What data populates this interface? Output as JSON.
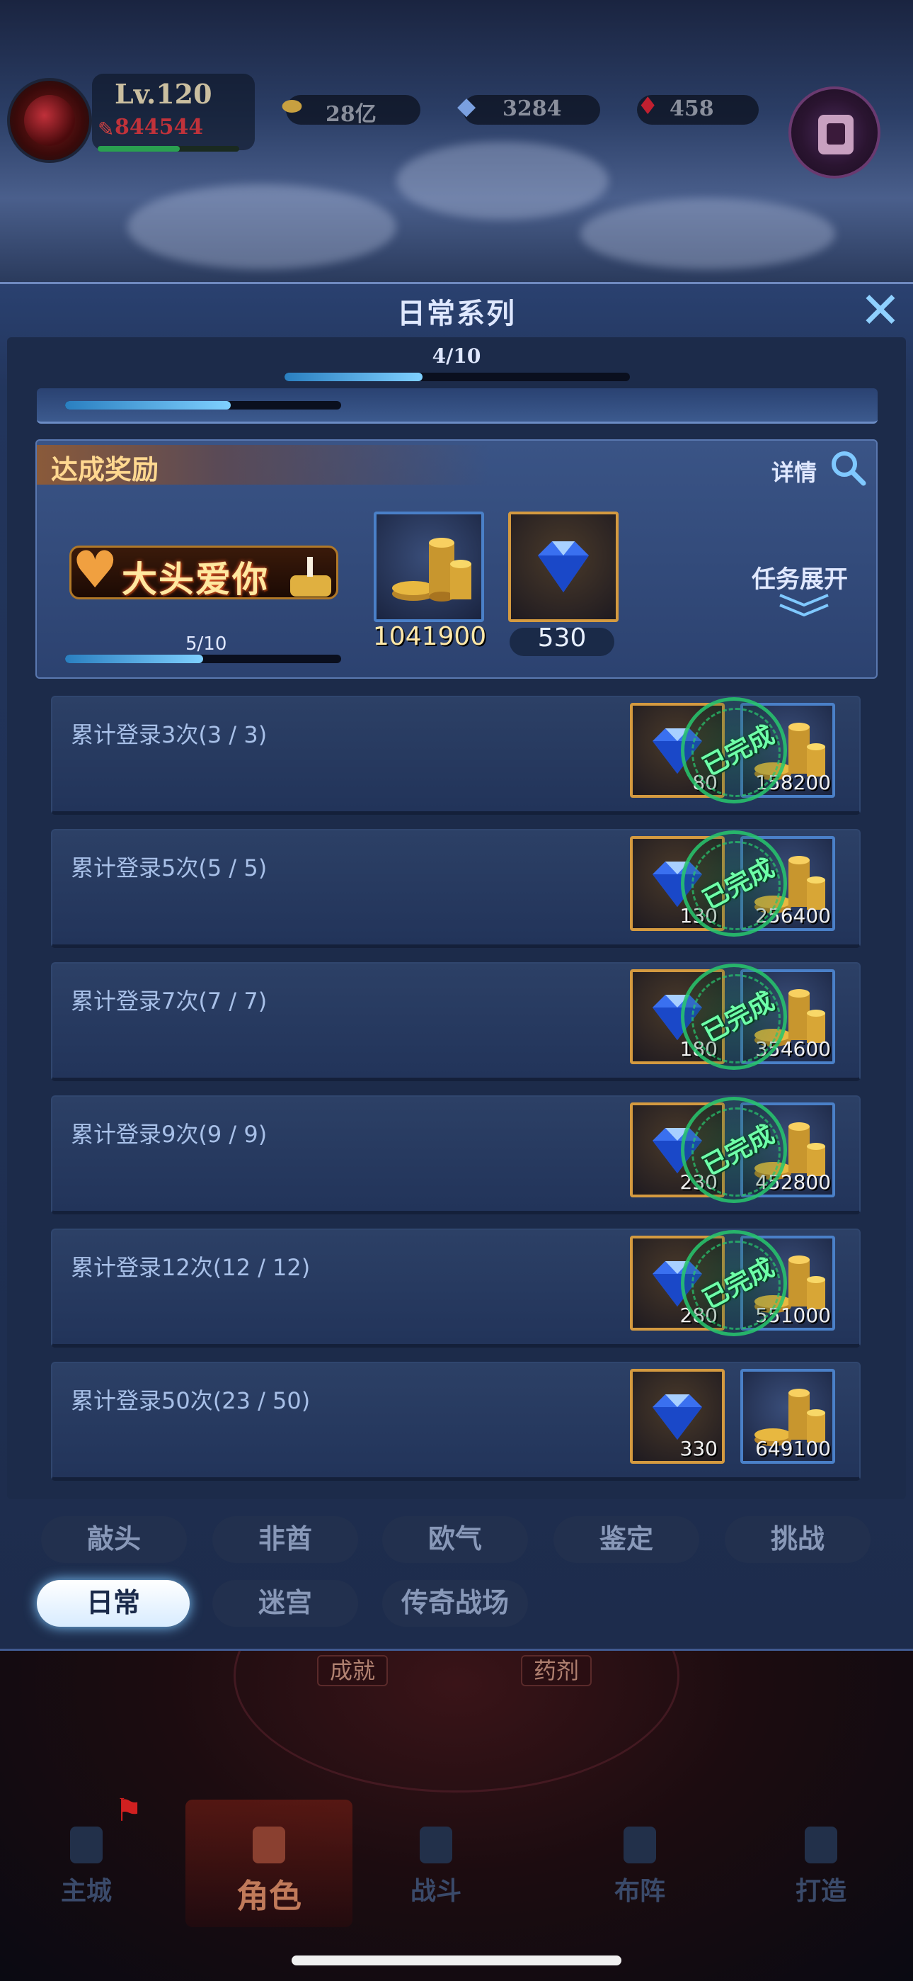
{
  "player": {
    "level": "Lv.120",
    "power": "844544",
    "hp_fraction": 0.58
  },
  "resources": [
    {
      "icon": "gold-coin-icon",
      "value": "28亿"
    },
    {
      "icon": "blue-crystal-icon",
      "value": "3284"
    },
    {
      "icon": "red-gem-icon",
      "value": "458"
    }
  ],
  "panel": {
    "title": "日常系列",
    "progress_label": "4/10",
    "progress_fraction": 0.4,
    "prev_progress_fraction": 0.6
  },
  "achievement": {
    "title": "达成奖励",
    "detail_label": "详情",
    "badge_text": "大头爱你",
    "progress_label": "5/10",
    "progress_fraction": 0.5,
    "reward_gold": "1041900",
    "reward_diamond": "530",
    "expand_label": "任务展开"
  },
  "tasks": [
    {
      "label": "累计登录3次(3 / 3)",
      "diamond": "80",
      "gold": "158200",
      "completed": true,
      "stamp": "已完成"
    },
    {
      "label": "累计登录5次(5 / 5)",
      "diamond": "130",
      "gold": "256400",
      "completed": true,
      "stamp": "已完成"
    },
    {
      "label": "累计登录7次(7 / 7)",
      "diamond": "180",
      "gold": "354600",
      "completed": true,
      "stamp": "已完成"
    },
    {
      "label": "累计登录9次(9 / 9)",
      "diamond": "230",
      "gold": "452800",
      "completed": true,
      "stamp": "已完成"
    },
    {
      "label": "累计登录12次(12 / 12)",
      "diamond": "280",
      "gold": "551000",
      "completed": true,
      "stamp": "已完成"
    },
    {
      "label": "累计登录50次(23 / 50)",
      "diamond": "330",
      "gold": "649100",
      "completed": false,
      "stamp": ""
    }
  ],
  "tabs_row1": [
    "敲头",
    "非酋",
    "欧气",
    "鉴定",
    "挑战"
  ],
  "tabs_row2": [
    "日常",
    "迷宫",
    "传奇战场"
  ],
  "active_tab": "日常",
  "background_tags": [
    "成就",
    "药剂"
  ],
  "bottom_nav": [
    "主城",
    "角色",
    "战斗",
    "布阵",
    "打造"
  ],
  "bottom_nav_active": "角色",
  "colors": {
    "accent_blue": "#7fd0ff",
    "gold_text": "#ffd890",
    "stamp_green": "#6effa8"
  }
}
